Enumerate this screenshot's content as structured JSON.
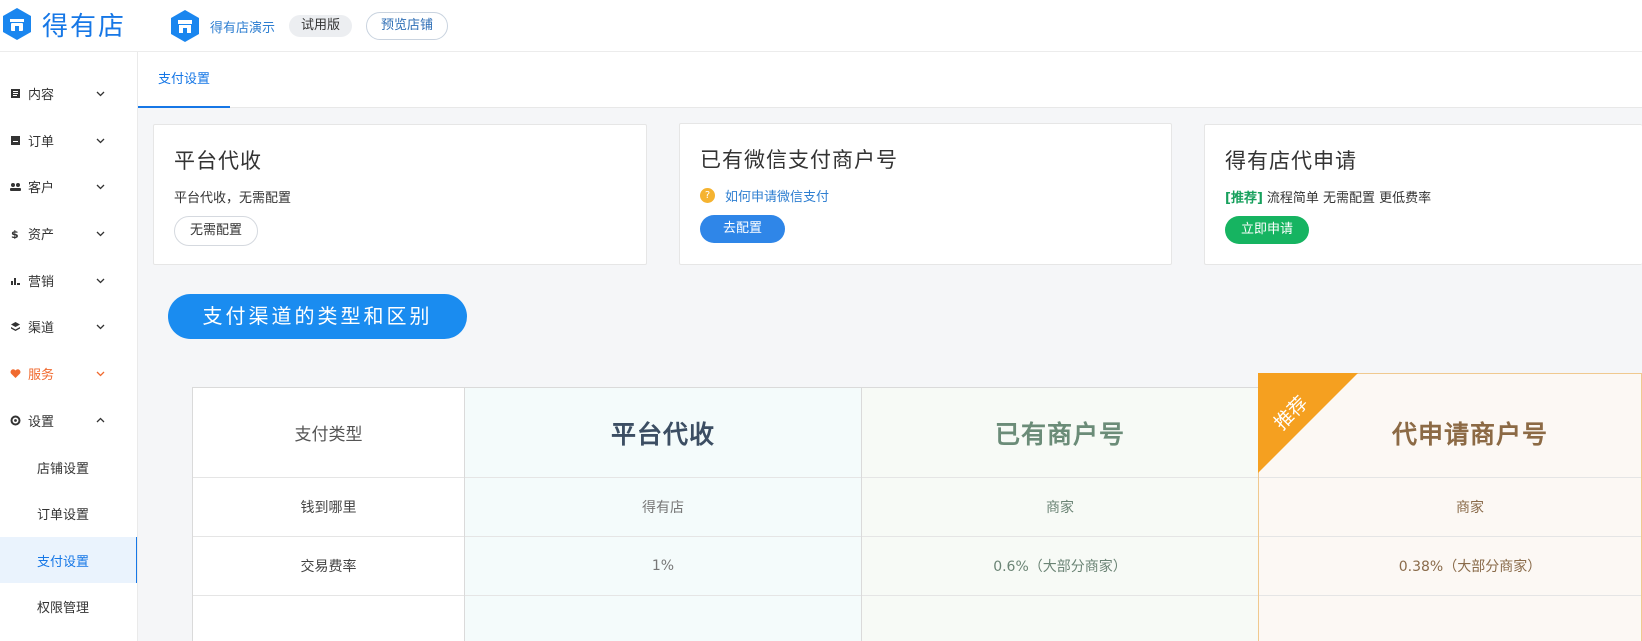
{
  "header": {
    "app_name": "得有店",
    "store_name": "得有店演示",
    "trial_badge": "试用版",
    "preview_button": "预览店铺",
    "colors": {
      "brand": "#1677e6"
    }
  },
  "sidebar": {
    "items": [
      {
        "label": "内容",
        "icon": "document-icon"
      },
      {
        "label": "订单",
        "icon": "order-icon"
      },
      {
        "label": "客户",
        "icon": "customers-icon"
      },
      {
        "label": "资产",
        "icon": "dollar-icon"
      },
      {
        "label": "营销",
        "icon": "bar-chart-icon"
      },
      {
        "label": "渠道",
        "icon": "layers-icon"
      },
      {
        "label": "服务",
        "icon": "heart-icon",
        "highlight": "#f06a2f"
      },
      {
        "label": "设置",
        "icon": "gear-icon",
        "expanded": true
      }
    ],
    "sub_items": [
      "店铺设置",
      "订单设置",
      "支付设置",
      "权限管理"
    ],
    "selected_sub": "支付设置"
  },
  "tabs": {
    "active": "支付设置"
  },
  "cards": [
    {
      "title": "平台代收",
      "desc": "平台代收，无需配置",
      "button": "无需配置"
    },
    {
      "title": "已有微信支付商户号",
      "link": "如何申请微信支付",
      "button": "去配置"
    },
    {
      "title": "得有店代申请",
      "tag": "[推荐]",
      "desc": "流程简单 无需配置 更低费率",
      "button": "立即申请"
    }
  ],
  "section_title": "支付渠道的类型和区别",
  "comparison": {
    "headers": [
      "支付类型",
      "平台代收",
      "已有商户号",
      "代申请商户号"
    ],
    "ribbon": "推荐",
    "rows": [
      {
        "label": "钱到哪里",
        "values": [
          "得有店",
          "商家",
          "商家"
        ]
      },
      {
        "label": "交易费率",
        "values": [
          "1%",
          "0.6%（大部分商家）",
          "0.38%（大部分商家）"
        ]
      }
    ]
  }
}
